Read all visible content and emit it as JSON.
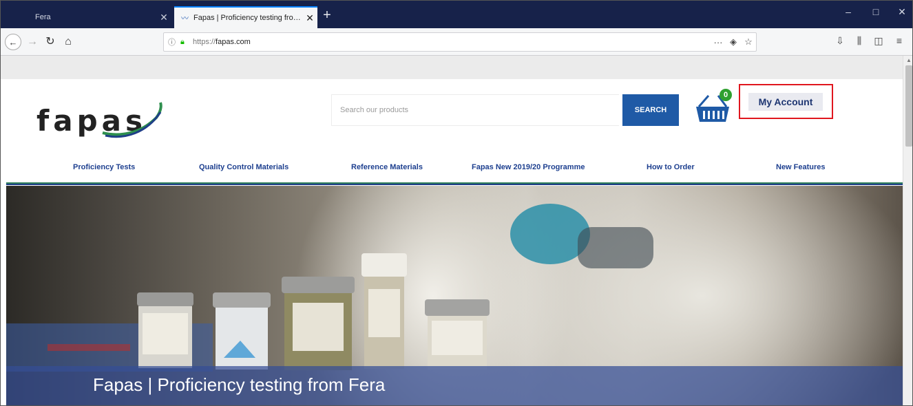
{
  "browser": {
    "tabs": [
      {
        "title": "Fera",
        "active": false
      },
      {
        "title": "Fapas | Proficiency testing fro…",
        "active": true
      }
    ],
    "new_tab_icon": "plus-icon",
    "url": "fapas.com",
    "url_protocol": "https://",
    "window_controls": {
      "minimize": "–",
      "maximize": "□",
      "close": "✕"
    }
  },
  "header": {
    "logo_text": "fapas",
    "search": {
      "placeholder": "Search our products",
      "value": "",
      "button_label": "SEARCH"
    },
    "basket": {
      "count": "0"
    },
    "account_label": "My Account"
  },
  "nav": {
    "items": [
      {
        "label": "Proficiency Tests"
      },
      {
        "label": "Quality Control Materials"
      },
      {
        "label": "Reference Materials"
      },
      {
        "label": "Fapas New 2019/20 Programme"
      },
      {
        "label": "How to Order"
      },
      {
        "label": "New Features"
      }
    ]
  },
  "hero": {
    "title": "Fapas | Proficiency testing from Fera"
  },
  "colors": {
    "tabbar": "#17224a",
    "accent_blue": "#1f5aa6",
    "nav_text": "#1d3f8f",
    "highlight_box": "#e0161e",
    "badge_green": "#2fa02f"
  }
}
